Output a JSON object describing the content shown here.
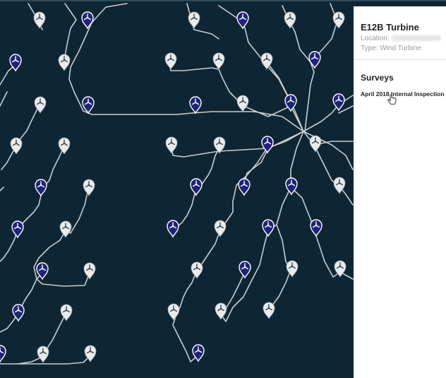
{
  "map": {
    "turbines": [
      {
        "id": 1,
        "status": "inspected"
      }
    ],
    "pin_colors": {
      "selected": "#1e237c",
      "default": "#e8ecee",
      "cable": "#c9d1d6",
      "background": "#0e2633"
    }
  },
  "panel": {
    "title": "E12B Turbine",
    "location_label": "Location:",
    "type_text": "Type: Wind Turbine",
    "surveys_heading": "Surveys",
    "surveys": [
      {
        "label": "April 2018 Internal Inspection"
      }
    ]
  }
}
